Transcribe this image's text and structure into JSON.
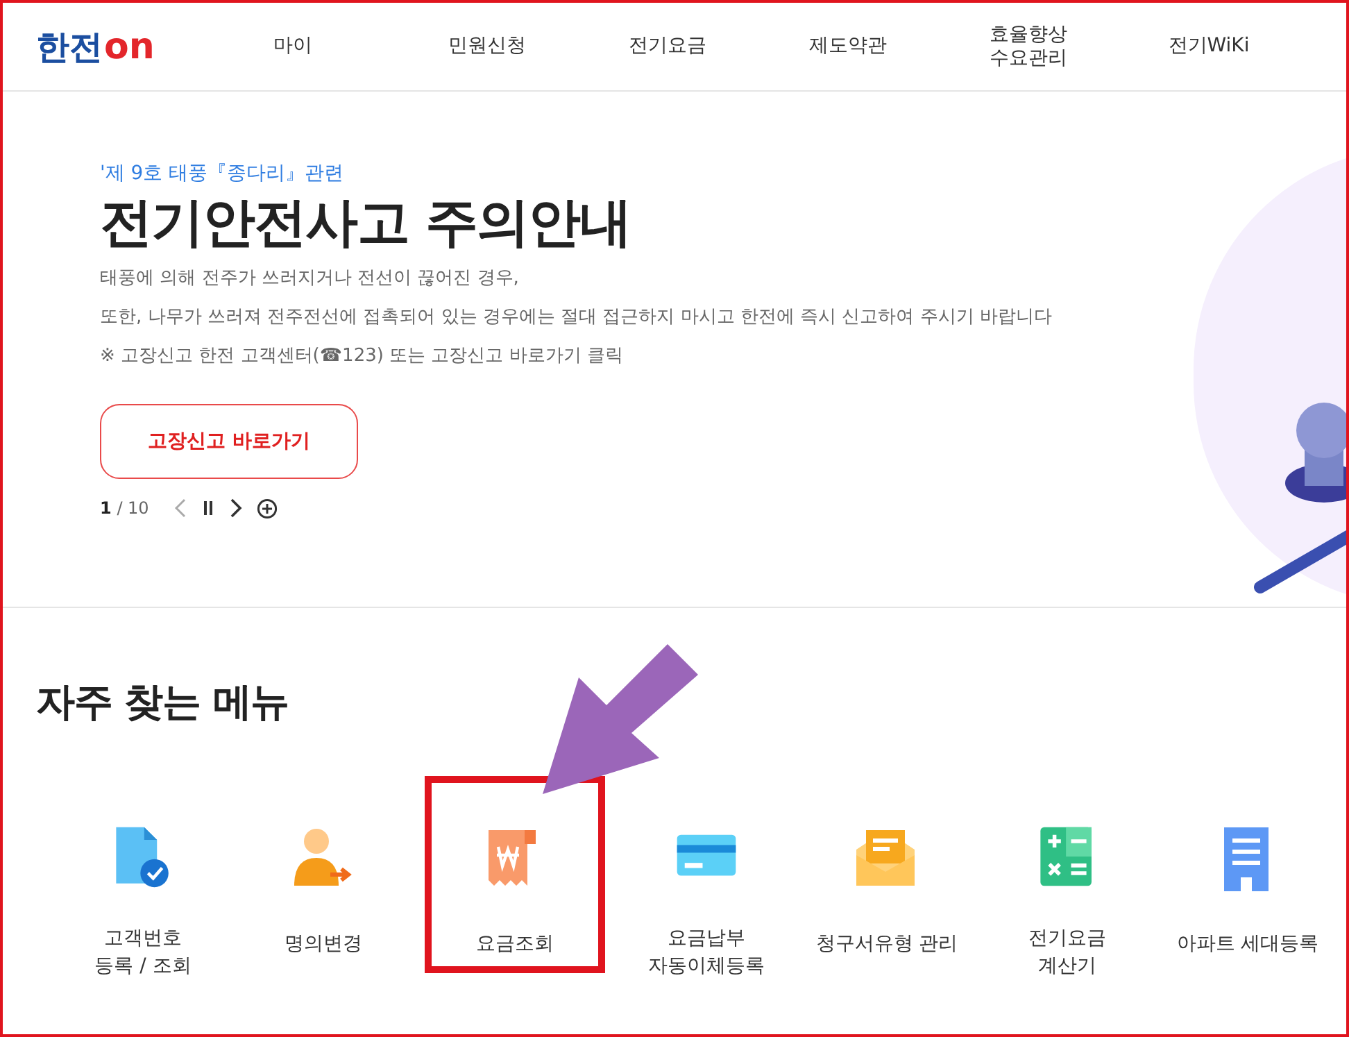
{
  "header": {
    "logo": {
      "main": "한전",
      "accent": "on"
    },
    "nav": [
      {
        "label": "마이"
      },
      {
        "label": "민원신청"
      },
      {
        "label": "전기요금"
      },
      {
        "label": "제도약관"
      },
      {
        "label": "효율향상\n수요관리"
      },
      {
        "label": "전기WiKi"
      }
    ]
  },
  "banner": {
    "eyebrow": "'제 9호 태풍『종다리』관련",
    "title": "전기안전사고 주의안내",
    "lines": [
      "태풍에 의해 전주가 쓰러지거나 전선이 끊어진 경우,",
      "또한, 나무가 쓰러져 전주전선에 접촉되어 있는 경우에는 절대 접근하지 마시고 한전에 즉시 신고하여 주시기 바랍니다",
      "※ 고장신고 한전 고객센터(☎123) 또는 고장신고 바로가기 클릭"
    ],
    "button": "고장신고 바로가기",
    "pager": {
      "current": "1",
      "total": "/ 10"
    }
  },
  "frequent_menu": {
    "title": "자주 찾는 메뉴",
    "items": [
      {
        "kind": "document-check",
        "label": "고객번호\n등록 / 조회",
        "highlighted": false
      },
      {
        "kind": "person-transfer",
        "label": "명의변경",
        "highlighted": false
      },
      {
        "kind": "receipt",
        "label": "요금조회",
        "highlighted": true
      },
      {
        "kind": "card",
        "label": "요금납부\n자동이체등록",
        "highlighted": false
      },
      {
        "kind": "envelope",
        "label": "청구서유형 관리",
        "highlighted": false
      },
      {
        "kind": "calculator",
        "label": "전기요금\n계산기",
        "highlighted": false
      },
      {
        "kind": "building",
        "label": "아파트 세대등록",
        "highlighted": false
      }
    ]
  }
}
